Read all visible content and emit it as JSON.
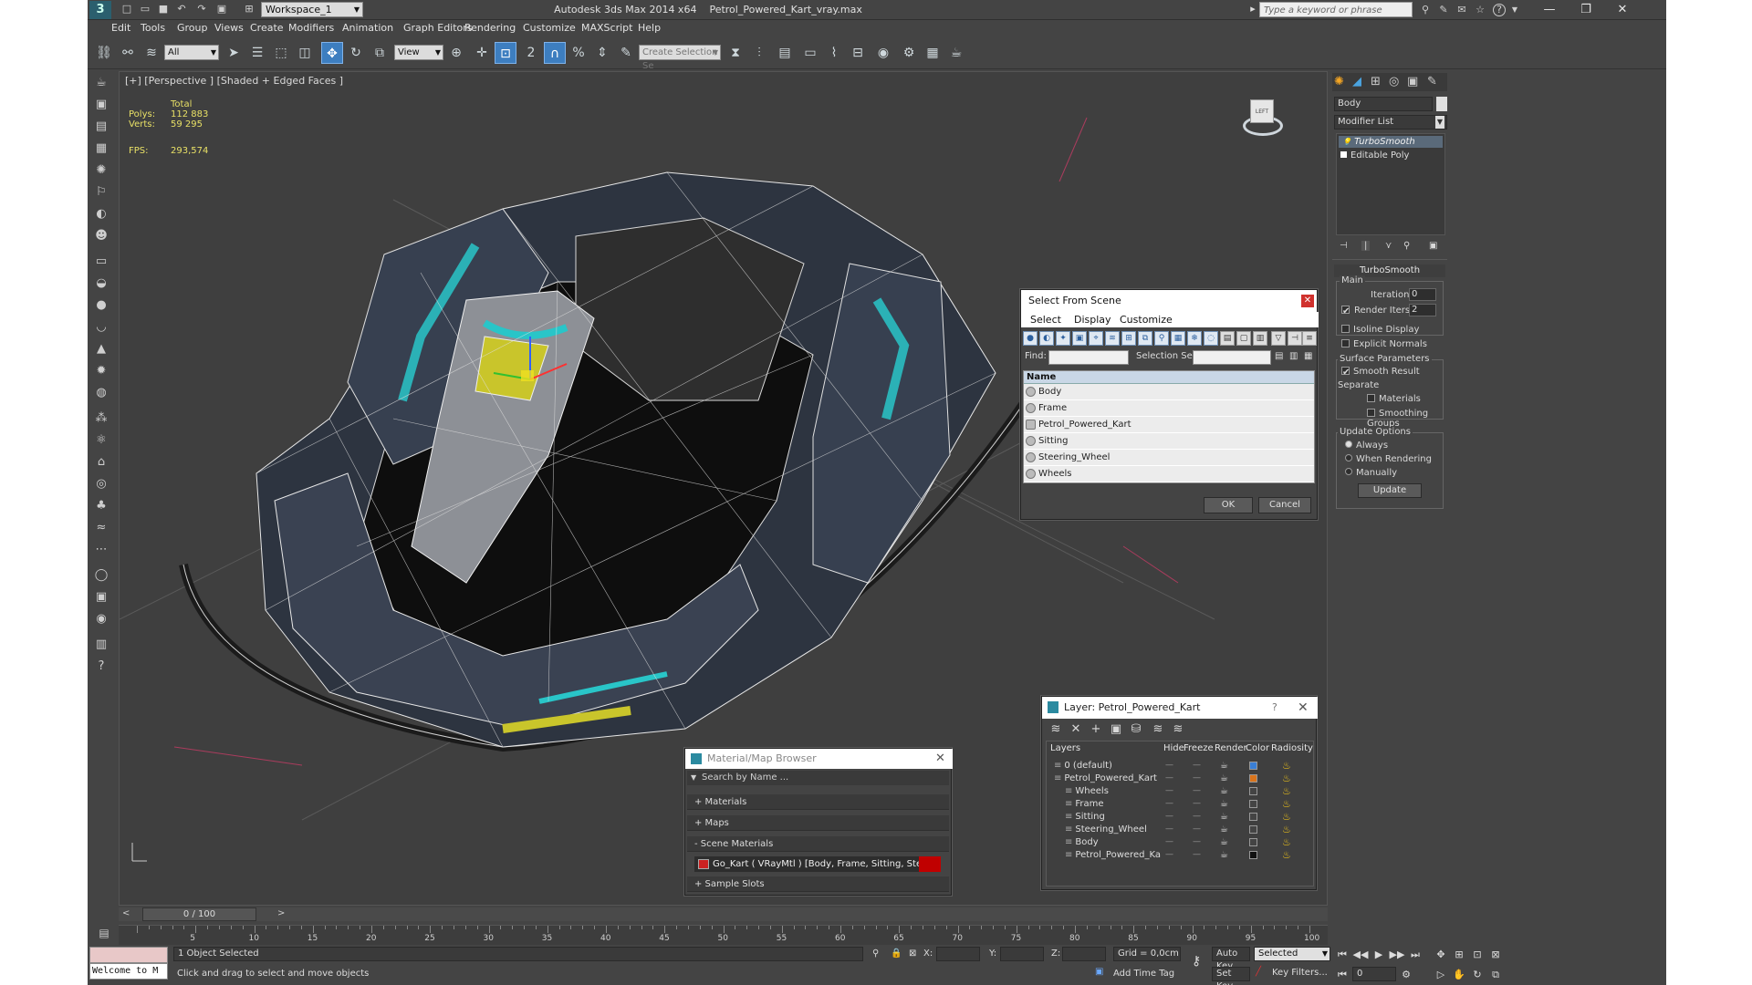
{
  "titlebar": {
    "workspace": "Workspace_1",
    "app_title": "Autodesk 3ds Max  2014 x64",
    "file_title": "Petrol_Powered_Kart_vray.max",
    "search_placeholder": "Type a keyword or phrase"
  },
  "menubar": [
    "Edit",
    "Tools",
    "Group",
    "Views",
    "Create",
    "Modifiers",
    "Animation",
    "Graph Editors",
    "Rendering",
    "Customize",
    "MAXScript",
    "Help"
  ],
  "toolbar": {
    "filter_value": "All",
    "refcoord_value": "View",
    "named_sel_value": "Create Selection Se"
  },
  "viewport": {
    "label": "[+] [Perspective ] [Shaded + Edged Faces ]",
    "stats_total": "Total",
    "polys_label": "Polys:",
    "polys_value": "112 883",
    "verts_label": "Verts:",
    "verts_value": "59 295",
    "fps_label": "FPS:",
    "fps_value": "293,574",
    "viewcube_label": "LEFT"
  },
  "select_from_scene": {
    "title": "Select From Scene",
    "tabs": [
      "Select",
      "Display",
      "Customize"
    ],
    "find_label": "Find:",
    "selection_set_label": "Selection Set:",
    "column_name": "Name",
    "items": [
      "Body",
      "Frame",
      "Petrol_Powered_Kart",
      "Sitting",
      "Steering_Wheel",
      "Wheels"
    ],
    "ok": "OK",
    "cancel": "Cancel"
  },
  "layer_dialog": {
    "title": "Layer: Petrol_Powered_Kart",
    "help": "?",
    "columns": [
      "Layers",
      "Hide",
      "Freeze",
      "Render",
      "Color",
      "Radiosity"
    ],
    "rows": [
      {
        "name": "0 (default)",
        "color": "#3a7fd5",
        "indent": 1
      },
      {
        "name": "Petrol_Powered_Kart",
        "color": "#d9741c",
        "indent": 1
      },
      {
        "name": "Wheels",
        "color": "#444444",
        "indent": 2
      },
      {
        "name": "Frame",
        "color": "#444444",
        "indent": 2
      },
      {
        "name": "Sitting",
        "color": "#444444",
        "indent": 2
      },
      {
        "name": "Steering_Wheel",
        "color": "#444444",
        "indent": 2
      },
      {
        "name": "Body",
        "color": "#444444",
        "indent": 2
      },
      {
        "name": "Petrol_Powered_Ka",
        "color": "#111111",
        "indent": 2
      }
    ]
  },
  "material_browser": {
    "title": "Material/Map Browser",
    "search_placeholder": "Search by Name ...",
    "materials": "+ Materials",
    "maps": "+ Maps",
    "scene_materials": "- Scene Materials",
    "scene_material_item": "Go_Kart  ( VRayMtl ) [Body, Frame, Sitting, Steering_Wheel, Wh...",
    "sample_slots": "+ Sample Slots"
  },
  "command_panel": {
    "object_name": "Body",
    "modifier_list": "Modifier List",
    "stack": [
      "TurboSmooth",
      "Editable Poly"
    ],
    "rollout_title": "TurboSmooth",
    "main_label": "Main",
    "iterations_label": "Iterations:",
    "iterations_value": "0",
    "render_iters_label": "Render Iters:",
    "render_iters_value": "2",
    "isoline_display": "Isoline Display",
    "explicit_normals": "Explicit Normals",
    "surface_parameters": "Surface Parameters",
    "smooth_result": "Smooth Result",
    "separate": "Separate",
    "materials": "Materials",
    "smoothing_groups": "Smoothing Groups",
    "update_options": "Update Options",
    "always": "Always",
    "when_rendering": "When Rendering",
    "manually": "Manually",
    "update_button": "Update"
  },
  "timeline": {
    "frame_display": "0 / 100",
    "ticks": [
      "5",
      "10",
      "15",
      "20",
      "25",
      "30",
      "35",
      "40",
      "45",
      "50",
      "55",
      "60",
      "65",
      "70",
      "75",
      "80",
      "85",
      "90",
      "95",
      "100"
    ]
  },
  "statusbar": {
    "listener_text": "Welcome to M",
    "selection_status": "1 Object Selected",
    "prompt": "Click and drag to select and move objects",
    "x_label": "X:",
    "y_label": "Y:",
    "z_label": "Z:",
    "grid": "Grid = 0,0cm",
    "add_time_tag": "Add Time Tag",
    "auto_key": "Auto Key",
    "set_key": "Set Key",
    "selected_value": "Selected",
    "key_filters": "Key Filters...",
    "frame_value": "0"
  }
}
